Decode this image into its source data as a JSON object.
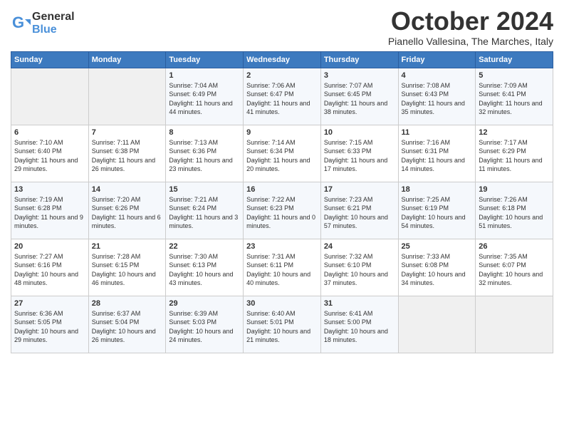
{
  "logo": {
    "general": "General",
    "blue": "Blue"
  },
  "title": "October 2024",
  "location": "Pianello Vallesina, The Marches, Italy",
  "days_of_week": [
    "Sunday",
    "Monday",
    "Tuesday",
    "Wednesday",
    "Thursday",
    "Friday",
    "Saturday"
  ],
  "weeks": [
    [
      {
        "day": "",
        "info": ""
      },
      {
        "day": "",
        "info": ""
      },
      {
        "day": "1",
        "info": "Sunrise: 7:04 AM\nSunset: 6:49 PM\nDaylight: 11 hours and 44 minutes."
      },
      {
        "day": "2",
        "info": "Sunrise: 7:06 AM\nSunset: 6:47 PM\nDaylight: 11 hours and 41 minutes."
      },
      {
        "day": "3",
        "info": "Sunrise: 7:07 AM\nSunset: 6:45 PM\nDaylight: 11 hours and 38 minutes."
      },
      {
        "day": "4",
        "info": "Sunrise: 7:08 AM\nSunset: 6:43 PM\nDaylight: 11 hours and 35 minutes."
      },
      {
        "day": "5",
        "info": "Sunrise: 7:09 AM\nSunset: 6:41 PM\nDaylight: 11 hours and 32 minutes."
      }
    ],
    [
      {
        "day": "6",
        "info": "Sunrise: 7:10 AM\nSunset: 6:40 PM\nDaylight: 11 hours and 29 minutes."
      },
      {
        "day": "7",
        "info": "Sunrise: 7:11 AM\nSunset: 6:38 PM\nDaylight: 11 hours and 26 minutes."
      },
      {
        "day": "8",
        "info": "Sunrise: 7:13 AM\nSunset: 6:36 PM\nDaylight: 11 hours and 23 minutes."
      },
      {
        "day": "9",
        "info": "Sunrise: 7:14 AM\nSunset: 6:34 PM\nDaylight: 11 hours and 20 minutes."
      },
      {
        "day": "10",
        "info": "Sunrise: 7:15 AM\nSunset: 6:33 PM\nDaylight: 11 hours and 17 minutes."
      },
      {
        "day": "11",
        "info": "Sunrise: 7:16 AM\nSunset: 6:31 PM\nDaylight: 11 hours and 14 minutes."
      },
      {
        "day": "12",
        "info": "Sunrise: 7:17 AM\nSunset: 6:29 PM\nDaylight: 11 hours and 11 minutes."
      }
    ],
    [
      {
        "day": "13",
        "info": "Sunrise: 7:19 AM\nSunset: 6:28 PM\nDaylight: 11 hours and 9 minutes."
      },
      {
        "day": "14",
        "info": "Sunrise: 7:20 AM\nSunset: 6:26 PM\nDaylight: 11 hours and 6 minutes."
      },
      {
        "day": "15",
        "info": "Sunrise: 7:21 AM\nSunset: 6:24 PM\nDaylight: 11 hours and 3 minutes."
      },
      {
        "day": "16",
        "info": "Sunrise: 7:22 AM\nSunset: 6:23 PM\nDaylight: 11 hours and 0 minutes."
      },
      {
        "day": "17",
        "info": "Sunrise: 7:23 AM\nSunset: 6:21 PM\nDaylight: 10 hours and 57 minutes."
      },
      {
        "day": "18",
        "info": "Sunrise: 7:25 AM\nSunset: 6:19 PM\nDaylight: 10 hours and 54 minutes."
      },
      {
        "day": "19",
        "info": "Sunrise: 7:26 AM\nSunset: 6:18 PM\nDaylight: 10 hours and 51 minutes."
      }
    ],
    [
      {
        "day": "20",
        "info": "Sunrise: 7:27 AM\nSunset: 6:16 PM\nDaylight: 10 hours and 48 minutes."
      },
      {
        "day": "21",
        "info": "Sunrise: 7:28 AM\nSunset: 6:15 PM\nDaylight: 10 hours and 46 minutes."
      },
      {
        "day": "22",
        "info": "Sunrise: 7:30 AM\nSunset: 6:13 PM\nDaylight: 10 hours and 43 minutes."
      },
      {
        "day": "23",
        "info": "Sunrise: 7:31 AM\nSunset: 6:11 PM\nDaylight: 10 hours and 40 minutes."
      },
      {
        "day": "24",
        "info": "Sunrise: 7:32 AM\nSunset: 6:10 PM\nDaylight: 10 hours and 37 minutes."
      },
      {
        "day": "25",
        "info": "Sunrise: 7:33 AM\nSunset: 6:08 PM\nDaylight: 10 hours and 34 minutes."
      },
      {
        "day": "26",
        "info": "Sunrise: 7:35 AM\nSunset: 6:07 PM\nDaylight: 10 hours and 32 minutes."
      }
    ],
    [
      {
        "day": "27",
        "info": "Sunrise: 6:36 AM\nSunset: 5:05 PM\nDaylight: 10 hours and 29 minutes."
      },
      {
        "day": "28",
        "info": "Sunrise: 6:37 AM\nSunset: 5:04 PM\nDaylight: 10 hours and 26 minutes."
      },
      {
        "day": "29",
        "info": "Sunrise: 6:39 AM\nSunset: 5:03 PM\nDaylight: 10 hours and 24 minutes."
      },
      {
        "day": "30",
        "info": "Sunrise: 6:40 AM\nSunset: 5:01 PM\nDaylight: 10 hours and 21 minutes."
      },
      {
        "day": "31",
        "info": "Sunrise: 6:41 AM\nSunset: 5:00 PM\nDaylight: 10 hours and 18 minutes."
      },
      {
        "day": "",
        "info": ""
      },
      {
        "day": "",
        "info": ""
      }
    ]
  ]
}
